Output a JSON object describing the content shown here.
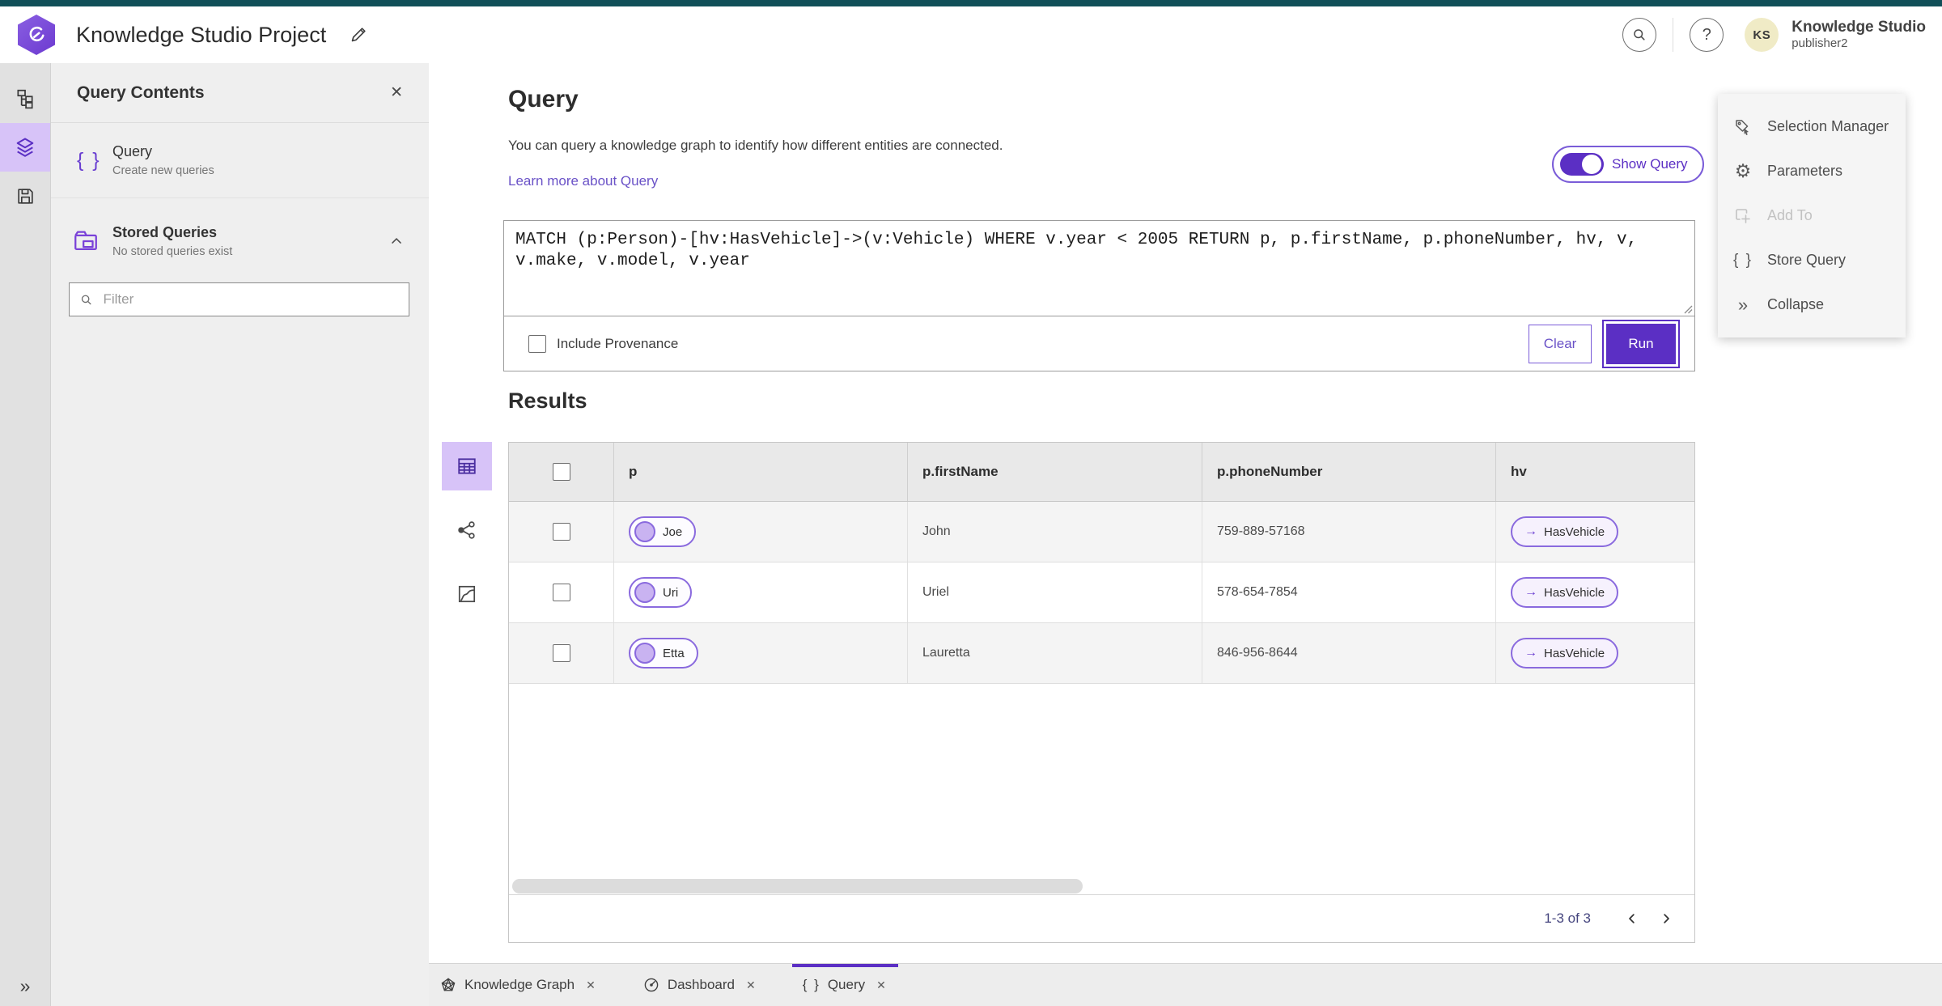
{
  "header": {
    "title": "Knowledge Studio Project",
    "user": {
      "initials": "KS",
      "product": "Knowledge Studio",
      "username": "publisher2"
    }
  },
  "icons": {
    "close": "✕",
    "help": "?",
    "braces": "{ }",
    "expand": "»",
    "arrow": "→",
    "gear": "⚙"
  },
  "panel": {
    "title": "Query Contents",
    "items": [
      {
        "title": "Query",
        "subtitle": "Create new queries"
      },
      {
        "title": "Stored Queries",
        "subtitle": "No stored queries exist"
      }
    ],
    "filter_placeholder": "Filter"
  },
  "query_section": {
    "title": "Query",
    "description": "You can query a knowledge graph to identify how different entities are connected.",
    "link": "Learn more about Query",
    "show_query_label": "Show Query",
    "query_text": "MATCH (p:Person)-[hv:HasVehicle]->(v:Vehicle) WHERE v.year < 2005 RETURN p, p.firstName, p.phoneNumber, hv, v, v.make, v.model, v.year",
    "include_provenance_label": "Include Provenance",
    "clear_label": "Clear",
    "run_label": "Run"
  },
  "results": {
    "title": "Results",
    "columns": [
      "p",
      "p.firstName",
      "p.phoneNumber",
      "hv"
    ],
    "rows": [
      {
        "p": "Joe",
        "firstName": "John",
        "phoneNumber": "759-889-57168",
        "hv": "HasVehicle"
      },
      {
        "p": "Uri",
        "firstName": "Uriel",
        "phoneNumber": "578-654-7854",
        "hv": "HasVehicle"
      },
      {
        "p": "Etta",
        "firstName": "Lauretta",
        "phoneNumber": "846-956-8644",
        "hv": "HasVehicle"
      }
    ],
    "pagination": {
      "label": "1-3 of 3"
    }
  },
  "right_menu": {
    "items": [
      {
        "label": "Selection Manager"
      },
      {
        "label": "Parameters"
      },
      {
        "label": "Add To",
        "disabled": true
      },
      {
        "label": "Store Query"
      },
      {
        "label": "Collapse"
      }
    ]
  },
  "tabs": [
    {
      "label": "Knowledge Graph"
    },
    {
      "label": "Dashboard"
    },
    {
      "label": "Query",
      "active": true
    }
  ],
  "colors": {
    "accent_purple": "#5b2fc4",
    "accent_purple_light": "#d7c3f8",
    "teal_bar": "#114f58",
    "link_purple": "#6a52c7",
    "node_fill": "#c9b3f1"
  }
}
